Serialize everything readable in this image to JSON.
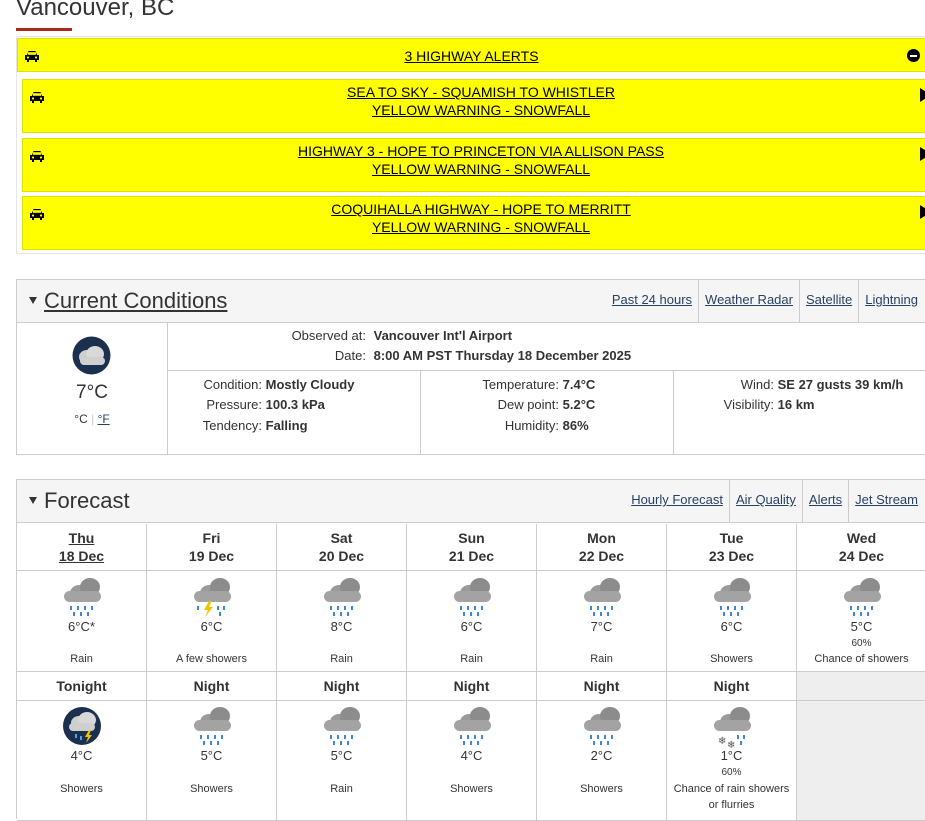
{
  "title": "Vancouver, BC",
  "alerts": {
    "header": "3 HIGHWAY ALERTS",
    "items": [
      {
        "line1": "SEA TO SKY - SQUAMISH TO WHISTLER",
        "line2": "YELLOW WARNING - SNOWFALL"
      },
      {
        "line1": "HIGHWAY 3 - HOPE TO PRINCETON VIA ALLISON PASS",
        "line2": "YELLOW WARNING - SNOWFALL"
      },
      {
        "line1": "COQUIHALLA HIGHWAY - HOPE TO MERRITT",
        "line2": "YELLOW WARNING - SNOWFALL"
      }
    ]
  },
  "current": {
    "heading": "Current Conditions",
    "links": [
      "Past 24 hours",
      "Weather Radar",
      "Satellite",
      "Lightning"
    ],
    "temp": "7°C",
    "unit_c": "°C",
    "unit_f": "°F",
    "observed_label": "Observed at:",
    "observed_value": "Vancouver Int'l Airport",
    "date_label": "Date:",
    "date_value": "8:00 AM PST Thursday 18 December 2025",
    "condition_label": "Condition:",
    "condition_value": "Mostly Cloudy",
    "pressure_label": "Pressure:",
    "pressure_value": "100.3 kPa",
    "tendency_label": "Tendency:",
    "tendency_value": "Falling",
    "temperature_label": "Temperature:",
    "temperature_value": "7.4°C",
    "dewpoint_label": "Dew point:",
    "dewpoint_value": "5.2°C",
    "humidity_label": "Humidity:",
    "humidity_value": "86%",
    "wind_label": "Wind:",
    "wind_value": "SE 27 gusts 39 km/h",
    "visibility_label": "Visibility:",
    "visibility_value": "16 km"
  },
  "forecast": {
    "heading": "Forecast",
    "links": [
      "Hourly Forecast",
      "Air Quality",
      "Alerts",
      "Jet Stream"
    ],
    "days": [
      {
        "name": "Thu",
        "date": "18 Dec",
        "temp": "6°C*",
        "pop": "",
        "summary": "Rain",
        "icon": "rain-icon"
      },
      {
        "name": "Fri",
        "date": "19 Dec",
        "temp": "6°C",
        "pop": "",
        "summary": "A few showers",
        "icon": "thunder-showers-icon"
      },
      {
        "name": "Sat",
        "date": "20 Dec",
        "temp": "8°C",
        "pop": "",
        "summary": "Rain",
        "icon": "rain-icon"
      },
      {
        "name": "Sun",
        "date": "21 Dec",
        "temp": "6°C",
        "pop": "",
        "summary": "Rain",
        "icon": "rain-icon"
      },
      {
        "name": "Mon",
        "date": "22 Dec",
        "temp": "7°C",
        "pop": "",
        "summary": "Rain",
        "icon": "rain-icon"
      },
      {
        "name": "Tue",
        "date": "23 Dec",
        "temp": "6°C",
        "pop": "",
        "summary": "Showers",
        "icon": "rain-icon"
      },
      {
        "name": "Wed",
        "date": "24 Dec",
        "temp": "5°C",
        "pop": "60%",
        "summary": "Chance of showers",
        "icon": "rain-icon"
      }
    ],
    "nights": [
      {
        "name": "Tonight",
        "temp": "4°C",
        "pop": "",
        "summary": "Showers",
        "summary2": "",
        "icon": "night-showers-icon"
      },
      {
        "name": "Night",
        "temp": "5°C",
        "pop": "",
        "summary": "Showers",
        "summary2": "",
        "icon": "rain-icon"
      },
      {
        "name": "Night",
        "temp": "5°C",
        "pop": "",
        "summary": "Rain",
        "summary2": "",
        "icon": "rain-icon"
      },
      {
        "name": "Night",
        "temp": "4°C",
        "pop": "",
        "summary": "Showers",
        "summary2": "",
        "icon": "rain-icon"
      },
      {
        "name": "Night",
        "temp": "2°C",
        "pop": "",
        "summary": "Showers",
        "summary2": "",
        "icon": "rain-icon"
      },
      {
        "name": "Night",
        "temp": "1°C",
        "pop": "60%",
        "summary": "Chance of rain showers",
        "summary2": "or flurries",
        "icon": "rain-snow-icon"
      }
    ]
  }
}
